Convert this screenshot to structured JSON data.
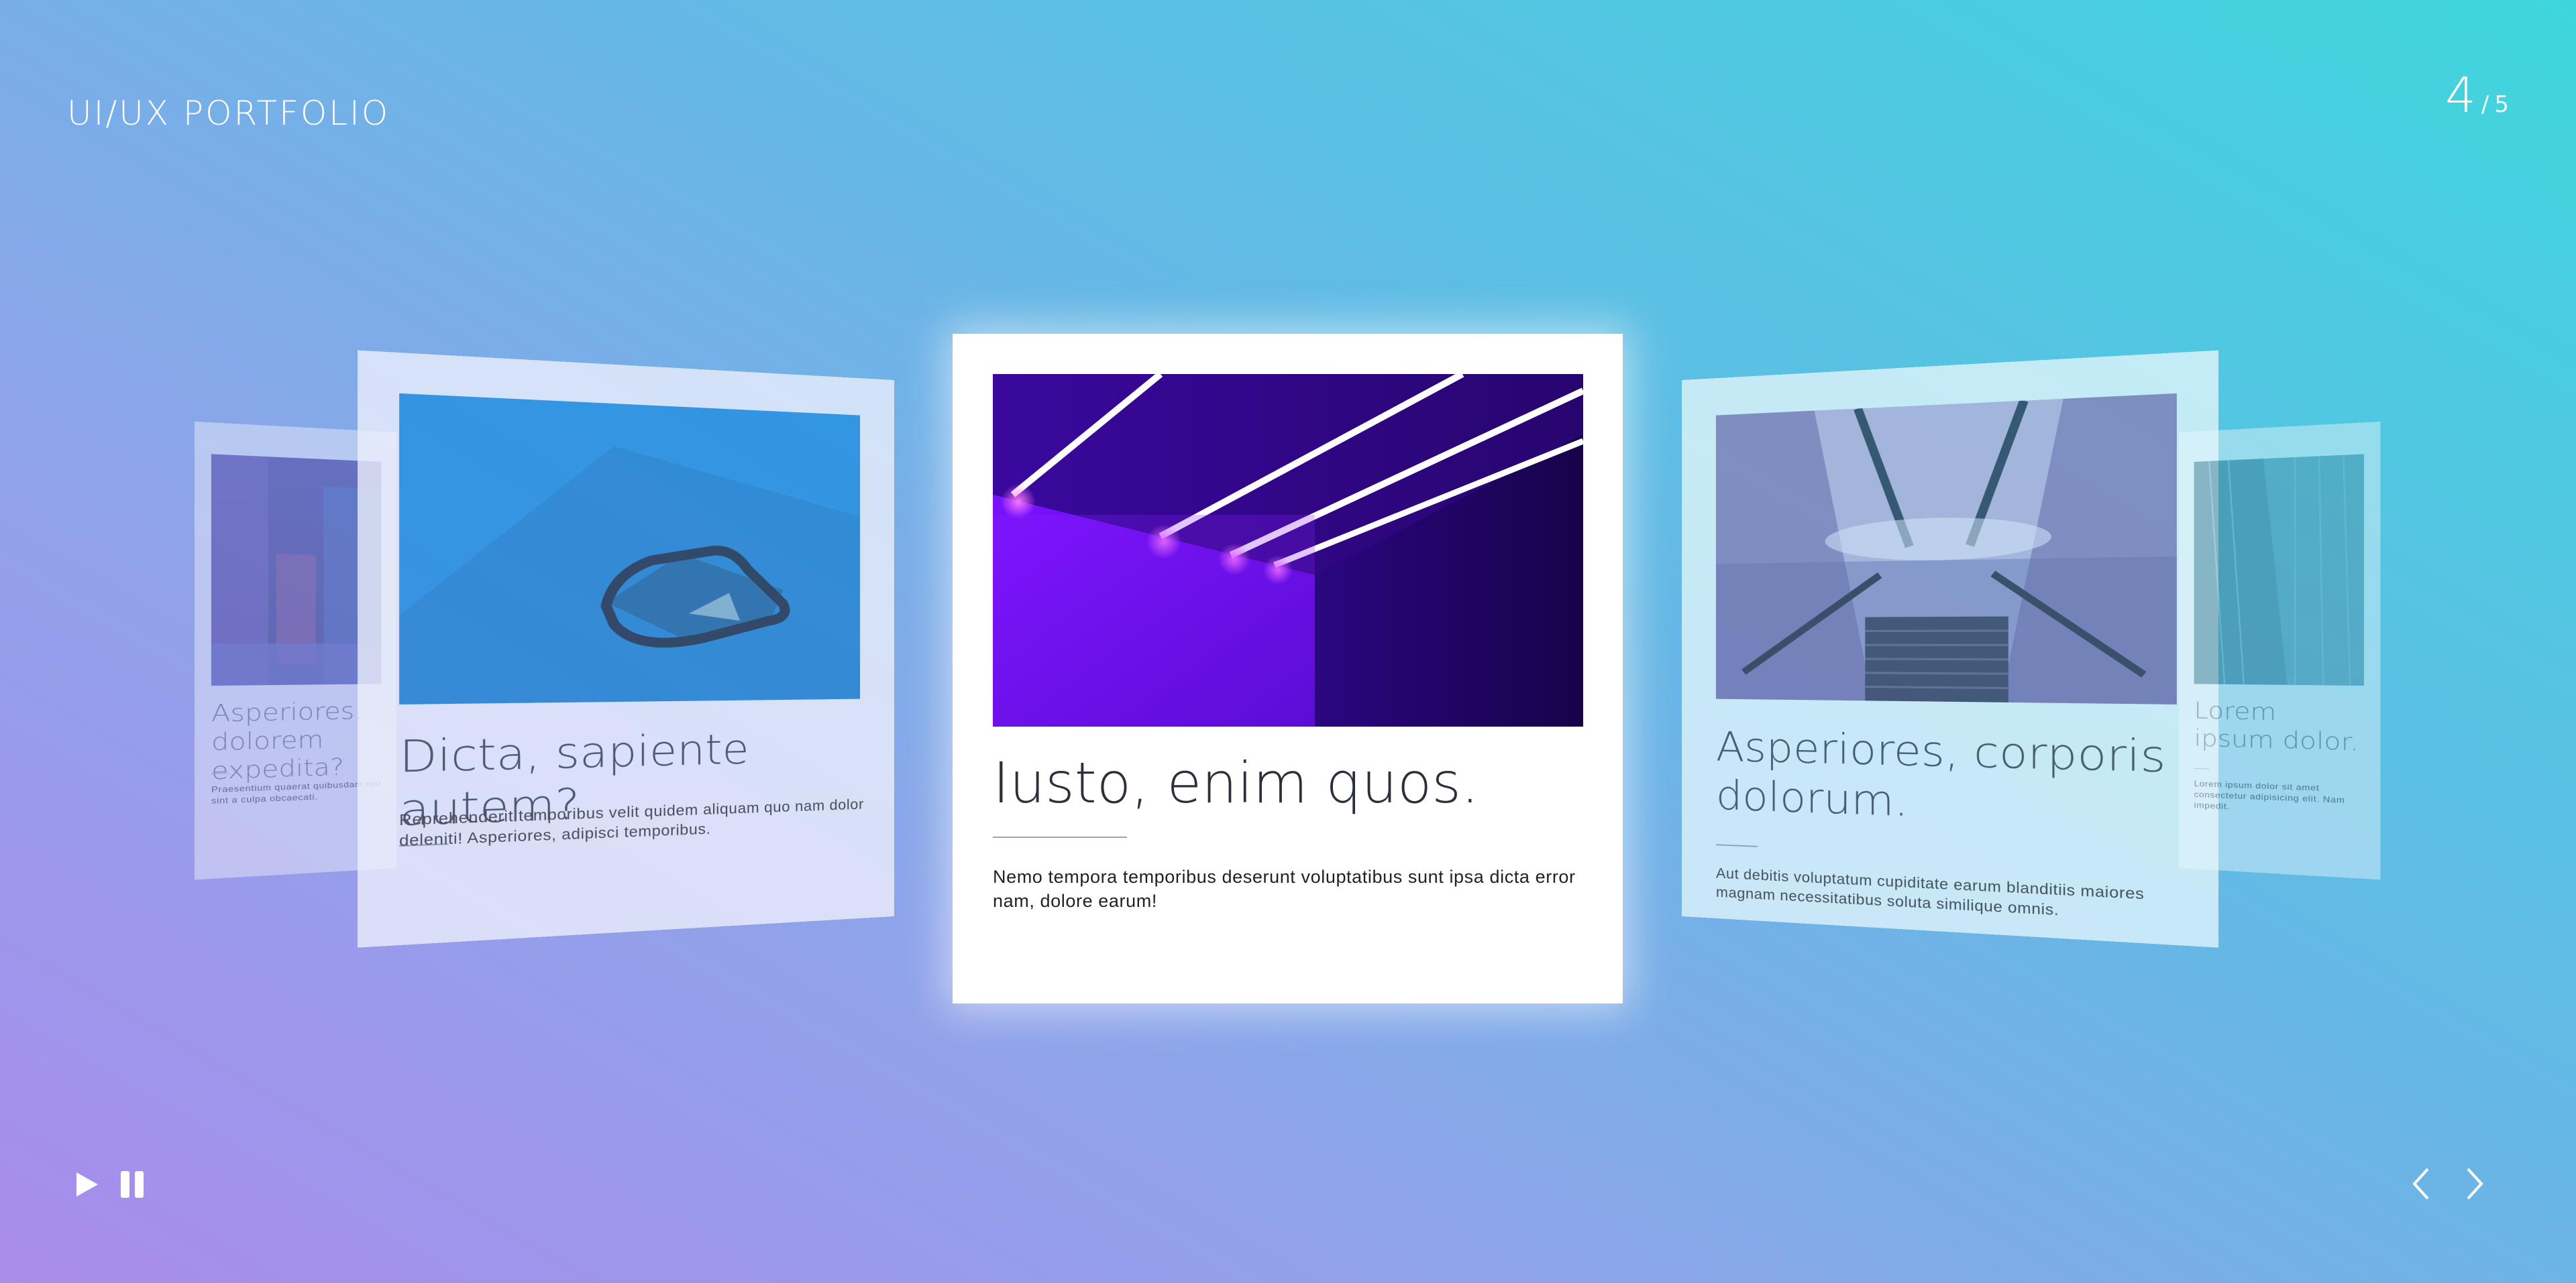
{
  "brand": "UI/UX PORTFOLIO",
  "counter": {
    "current": "4",
    "separator": "/",
    "total": "5"
  },
  "colors": {
    "gradient_start": "#a98cec",
    "gradient_end": "#3ed6dd",
    "card_center_bg": "#ffffff",
    "neon_purple": "#8a22ff"
  },
  "cards": {
    "far_left": {
      "title": "Asperiores, dolorem expedita?",
      "desc": "Praesentium quaerat quibusdam nisi sint a culpa obcaecati."
    },
    "near_left": {
      "title": "Dicta, sapiente autem?",
      "desc": "Reprehenderit temporibus velit quidem aliquam quo nam dolor deleniti! Asperiores, adipisci temporibus."
    },
    "center": {
      "title": "Iusto, enim quos.",
      "desc": "Nemo tempora temporibus deserunt voluptatibus sunt ipsa dicta error nam, dolore earum!"
    },
    "near_right": {
      "title": "Asperiores, corporis dolorum.",
      "desc": "Aut debitis voluptatum cupiditate earum blanditiis maiores magnam necessitatibus soluta similique omnis."
    },
    "far_right": {
      "title": "Lorem ipsum dolor.",
      "desc": "Lorem ipsum dolor sit amet consectetur adipisicing elit. Nam impedit."
    }
  },
  "controls": {
    "play_icon": "play-icon",
    "pause_icon": "pause-icon"
  },
  "navigation": {
    "prev_icon": "chevron-left-icon",
    "next_icon": "chevron-right-icon"
  }
}
